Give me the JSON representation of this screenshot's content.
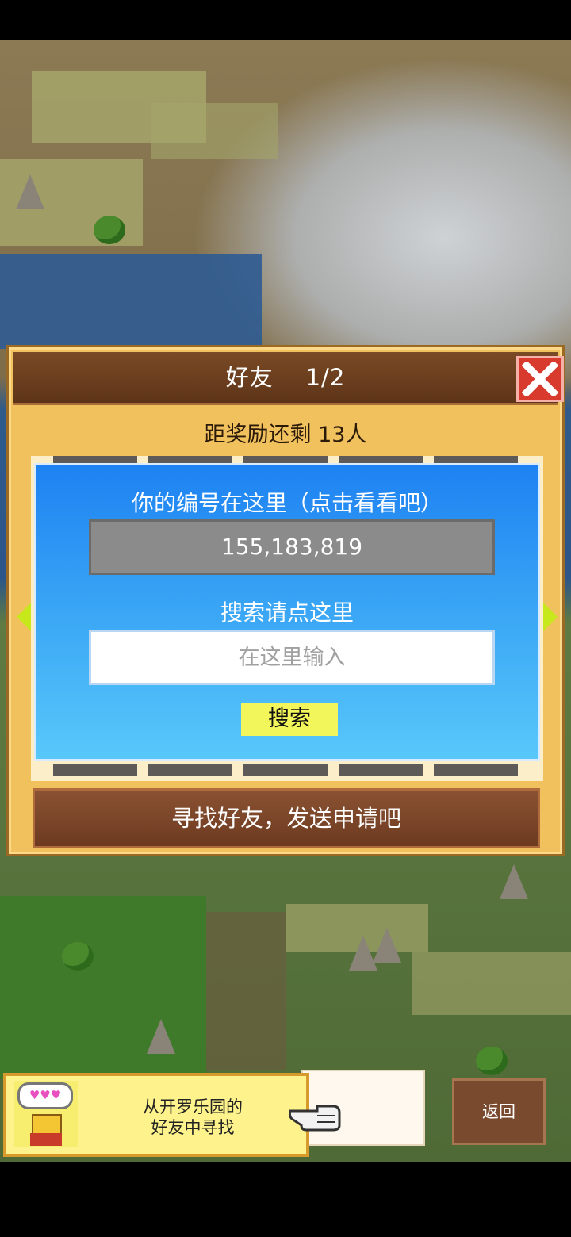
{
  "dialog": {
    "title": "好友    1/2",
    "subtitle": "距奖励还剩 13人",
    "id_label": "你的编号在这里（点击看看吧）",
    "id_value": "155,183,819",
    "search_label": "搜索请点这里",
    "search_placeholder": "在这里输入",
    "search_button": "搜索",
    "find_friends_button": "寻找好友，发送申请吧"
  },
  "promo": {
    "bubble_text": "♥♥♥",
    "text_line1": "从开罗乐园的",
    "text_line2": "好友中寻找"
  },
  "back_button": "返回",
  "icons": {
    "close": "close-icon",
    "prev": "arrow-left-icon",
    "next": "arrow-right-icon",
    "pointer": "pointing-hand-icon"
  },
  "colors": {
    "dialog_frame": "#f1c15e",
    "titlebar": "#6b3f1f",
    "panel_blue": "#1e82f2",
    "search_button": "#f2f65a",
    "close_red": "#d93a2e"
  }
}
